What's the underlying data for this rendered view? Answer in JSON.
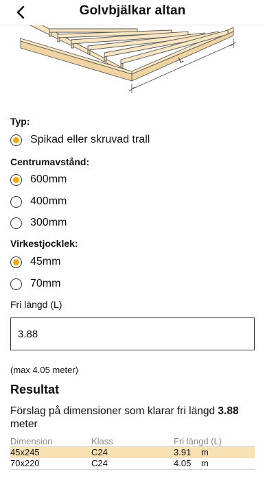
{
  "nav": {
    "title": "Golvbjälkar altan"
  },
  "illustration": {
    "dimension_label": "L"
  },
  "type_section": {
    "label": "Typ:",
    "options": [
      {
        "label": "Spikad eller skruvad trall",
        "selected": true
      }
    ]
  },
  "spacing_section": {
    "label": "Centrumavstånd:",
    "options": [
      {
        "label": "600mm",
        "selected": true
      },
      {
        "label": "400mm",
        "selected": false
      },
      {
        "label": "300mm",
        "selected": false
      }
    ]
  },
  "thickness_section": {
    "label": "Virkestjocklek:",
    "options": [
      {
        "label": "45mm",
        "selected": true
      },
      {
        "label": "70mm",
        "selected": false
      }
    ]
  },
  "length": {
    "label": "Fri längd (L)",
    "value": "3.88",
    "max_note": "(max 4.05 meter)"
  },
  "result": {
    "heading": "Resultat",
    "suggestion_prefix": "Förslag på dimensioner som klarar fri längd ",
    "suggestion_value": "3.88",
    "suggestion_suffix": " meter",
    "table": {
      "headers": [
        "Dimension",
        "Klass",
        "Fri längd (L)"
      ],
      "rows": [
        {
          "dimension": "45x245",
          "class": "C24",
          "length": "3.91",
          "unit": "m",
          "highlight": true
        },
        {
          "dimension": "70x220",
          "class": "C24",
          "length": "4.05",
          "unit": "m",
          "highlight": false
        }
      ]
    }
  },
  "colors": {
    "accent": "#f2a900",
    "highlight_row": "#f8e2b4",
    "wood": "#f6e3bd"
  }
}
